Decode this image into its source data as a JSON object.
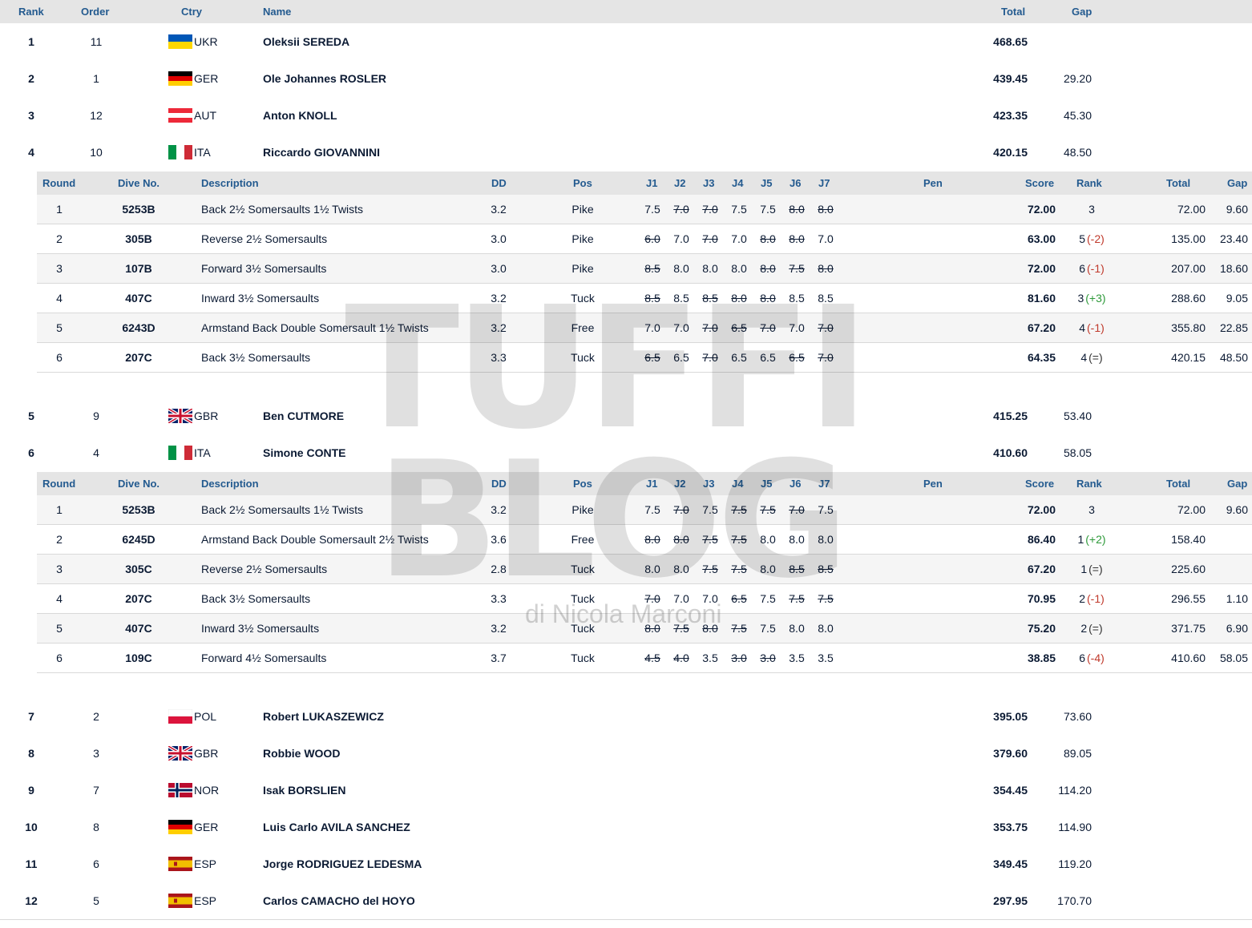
{
  "header": {
    "rank": "Rank",
    "order": "Order",
    "ctry": "Ctry",
    "name": "Name",
    "total": "Total",
    "gap": "Gap"
  },
  "dive_header": {
    "round": "Round",
    "dive_no": "Dive No.",
    "description": "Description",
    "dd": "DD",
    "pos": "Pos",
    "j1": "J1",
    "j2": "J2",
    "j3": "J3",
    "j4": "J4",
    "j5": "J5",
    "j6": "J6",
    "j7": "J7",
    "pen": "Pen",
    "score": "Score",
    "rank": "Rank",
    "total": "Total",
    "gap": "Gap"
  },
  "watermark": {
    "line1": "TUFFI",
    "line2": "BLOG",
    "line3": "di Nicola Marconi"
  },
  "athletes": [
    {
      "rank": "1",
      "order": "11",
      "flag": "ukr-flag",
      "ctry": "UKR",
      "name": "Oleksii SEREDA",
      "total": "468.65",
      "gap": ""
    },
    {
      "rank": "2",
      "order": "1",
      "flag": "ger-flag",
      "ctry": "GER",
      "name": "Ole Johannes ROSLER",
      "total": "439.45",
      "gap": "29.20"
    },
    {
      "rank": "3",
      "order": "12",
      "flag": "aut-flag",
      "ctry": "AUT",
      "name": "Anton KNOLL",
      "total": "423.35",
      "gap": "45.30"
    },
    {
      "rank": "4",
      "order": "10",
      "flag": "ita-flag",
      "ctry": "ITA",
      "name": "Riccardo GIOVANNINI",
      "total": "420.15",
      "gap": "48.50",
      "dives": [
        {
          "round": "1",
          "dive": "5253B",
          "desc": "Back 2½ Somersaults 1½ Twists",
          "dd": "3.2",
          "pos": "Pike",
          "j": [
            "7.5",
            "7.0",
            "7.0",
            "7.5",
            "7.5",
            "8.0",
            "8.0"
          ],
          "drop": [
            1,
            2,
            5,
            6
          ],
          "score": "72.00",
          "rank": "3",
          "rc": "",
          "total": "72.00",
          "gap": "9.60"
        },
        {
          "round": "2",
          "dive": "305B",
          "desc": "Reverse 2½ Somersaults",
          "dd": "3.0",
          "pos": "Pike",
          "j": [
            "6.0",
            "7.0",
            "7.0",
            "7.0",
            "8.0",
            "8.0",
            "7.0"
          ],
          "drop": [
            0,
            2,
            4,
            5
          ],
          "score": "63.00",
          "rank": "5",
          "rc": "(-2)",
          "total": "135.00",
          "gap": "23.40"
        },
        {
          "round": "3",
          "dive": "107B",
          "desc": "Forward 3½ Somersaults",
          "dd": "3.0",
          "pos": "Pike",
          "j": [
            "8.5",
            "8.0",
            "8.0",
            "8.0",
            "8.0",
            "7.5",
            "8.0"
          ],
          "drop": [
            0,
            4,
            5,
            6
          ],
          "score": "72.00",
          "rank": "6",
          "rc": "(-1)",
          "total": "207.00",
          "gap": "18.60"
        },
        {
          "round": "4",
          "dive": "407C",
          "desc": "Inward 3½ Somersaults",
          "dd": "3.2",
          "pos": "Tuck",
          "j": [
            "8.5",
            "8.5",
            "8.5",
            "8.0",
            "8.0",
            "8.5",
            "8.5"
          ],
          "drop": [
            0,
            2,
            3,
            4
          ],
          "score": "81.60",
          "rank": "3",
          "rc": "(+3)",
          "total": "288.60",
          "gap": "9.05"
        },
        {
          "round": "5",
          "dive": "6243D",
          "desc": "Armstand Back Double Somersault 1½ Twists",
          "dd": "3.2",
          "pos": "Free",
          "j": [
            "7.0",
            "7.0",
            "7.0",
            "6.5",
            "7.0",
            "7.0",
            "7.0"
          ],
          "drop": [
            2,
            3,
            4,
            6
          ],
          "score": "67.20",
          "rank": "4",
          "rc": "(-1)",
          "total": "355.80",
          "gap": "22.85"
        },
        {
          "round": "6",
          "dive": "207C",
          "desc": "Back 3½ Somersaults",
          "dd": "3.3",
          "pos": "Tuck",
          "j": [
            "6.5",
            "6.5",
            "7.0",
            "6.5",
            "6.5",
            "6.5",
            "7.0"
          ],
          "drop": [
            0,
            2,
            5,
            6
          ],
          "score": "64.35",
          "rank": "4",
          "rc": "(=)",
          "total": "420.15",
          "gap": "48.50"
        }
      ]
    },
    {
      "rank": "5",
      "order": "9",
      "flag": "gbr-flag",
      "ctry": "GBR",
      "name": "Ben CUTMORE",
      "total": "415.25",
      "gap": "53.40"
    },
    {
      "rank": "6",
      "order": "4",
      "flag": "ita-flag",
      "ctry": "ITA",
      "name": "Simone CONTE",
      "total": "410.60",
      "gap": "58.05",
      "dives": [
        {
          "round": "1",
          "dive": "5253B",
          "desc": "Back 2½ Somersaults 1½ Twists",
          "dd": "3.2",
          "pos": "Pike",
          "j": [
            "7.5",
            "7.0",
            "7.5",
            "7.5",
            "7.5",
            "7.0",
            "7.5"
          ],
          "drop": [
            1,
            3,
            4,
            5
          ],
          "score": "72.00",
          "rank": "3",
          "rc": "",
          "total": "72.00",
          "gap": "9.60"
        },
        {
          "round": "2",
          "dive": "6245D",
          "desc": "Armstand Back Double Somersault 2½ Twists",
          "dd": "3.6",
          "pos": "Free",
          "j": [
            "8.0",
            "8.0",
            "7.5",
            "7.5",
            "8.0",
            "8.0",
            "8.0"
          ],
          "drop": [
            0,
            1,
            2,
            3
          ],
          "score": "86.40",
          "rank": "1",
          "rc": "(+2)",
          "total": "158.40",
          "gap": ""
        },
        {
          "round": "3",
          "dive": "305C",
          "desc": "Reverse 2½ Somersaults",
          "dd": "2.8",
          "pos": "Tuck",
          "j": [
            "8.0",
            "8.0",
            "7.5",
            "7.5",
            "8.0",
            "8.5",
            "8.5"
          ],
          "drop": [
            2,
            3,
            5,
            6
          ],
          "score": "67.20",
          "rank": "1",
          "rc": "(=)",
          "total": "225.60",
          "gap": ""
        },
        {
          "round": "4",
          "dive": "207C",
          "desc": "Back 3½ Somersaults",
          "dd": "3.3",
          "pos": "Tuck",
          "j": [
            "7.0",
            "7.0",
            "7.0",
            "6.5",
            "7.5",
            "7.5",
            "7.5"
          ],
          "drop": [
            0,
            3,
            5,
            6
          ],
          "score": "70.95",
          "rank": "2",
          "rc": "(-1)",
          "total": "296.55",
          "gap": "1.10"
        },
        {
          "round": "5",
          "dive": "407C",
          "desc": "Inward 3½ Somersaults",
          "dd": "3.2",
          "pos": "Tuck",
          "j": [
            "8.0",
            "7.5",
            "8.0",
            "7.5",
            "7.5",
            "8.0",
            "8.0"
          ],
          "drop": [
            0,
            1,
            2,
            3
          ],
          "score": "75.20",
          "rank": "2",
          "rc": "(=)",
          "total": "371.75",
          "gap": "6.90"
        },
        {
          "round": "6",
          "dive": "109C",
          "desc": "Forward 4½ Somersaults",
          "dd": "3.7",
          "pos": "Tuck",
          "j": [
            "4.5",
            "4.0",
            "3.5",
            "3.0",
            "3.0",
            "3.5",
            "3.5"
          ],
          "drop": [
            0,
            1,
            3,
            4
          ],
          "score": "38.85",
          "rank": "6",
          "rc": "(-4)",
          "total": "410.60",
          "gap": "58.05"
        }
      ]
    },
    {
      "rank": "7",
      "order": "2",
      "flag": "pol-flag",
      "ctry": "POL",
      "name": "Robert LUKASZEWICZ",
      "total": "395.05",
      "gap": "73.60"
    },
    {
      "rank": "8",
      "order": "3",
      "flag": "gbr-flag",
      "ctry": "GBR",
      "name": "Robbie WOOD",
      "total": "379.60",
      "gap": "89.05"
    },
    {
      "rank": "9",
      "order": "7",
      "flag": "nor-flag",
      "ctry": "NOR",
      "name": "Isak BORSLIEN",
      "total": "354.45",
      "gap": "114.20"
    },
    {
      "rank": "10",
      "order": "8",
      "flag": "ger-flag",
      "ctry": "GER",
      "name": "Luis Carlo AVILA SANCHEZ",
      "total": "353.75",
      "gap": "114.90"
    },
    {
      "rank": "11",
      "order": "6",
      "flag": "esp-flag",
      "ctry": "ESP",
      "name": "Jorge RODRIGUEZ LEDESMA",
      "total": "349.45",
      "gap": "119.20"
    },
    {
      "rank": "12",
      "order": "5",
      "flag": "esp-flag",
      "ctry": "ESP",
      "name": "Carlos CAMACHO del HOYO",
      "total": "297.95",
      "gap": "170.70"
    }
  ]
}
